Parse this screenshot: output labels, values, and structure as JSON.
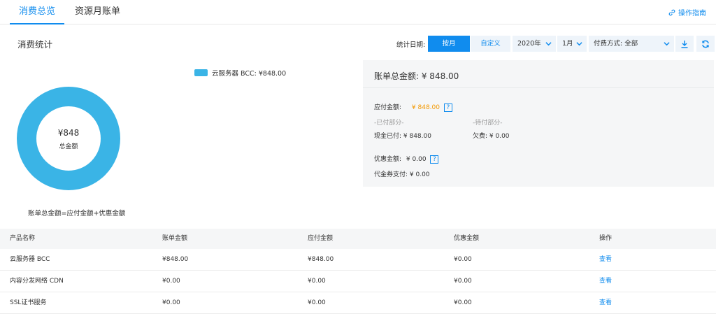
{
  "tabs": [
    {
      "label": "消费总览",
      "active": true
    },
    {
      "label": "资源月账单",
      "active": false
    }
  ],
  "guide_label": "操作指南",
  "section_title": "消费统计",
  "toolbar": {
    "date_label": "统计日期:",
    "month_btn": "按月",
    "custom_btn": "自定义",
    "year": "2020年",
    "month": "1月",
    "pay_method": "付费方式: 全部"
  },
  "chart_data": {
    "type": "pie",
    "categories": [
      "云服务器 BCC"
    ],
    "values": [
      848.0
    ],
    "legend": [
      "云服务器 BCC: ¥848.00"
    ],
    "center_value": "¥848",
    "center_label": "总金额",
    "colors": [
      "#3ab4e6"
    ]
  },
  "formula": "账单总金额=应付金额+优惠金额",
  "panel": {
    "total": "账单总金额:  ¥ 848.00",
    "payable_label": "应付金额:",
    "payable_value": "¥ 848.00",
    "paid_part": "-已付部分-",
    "pending_part": "-待付部分-",
    "cash_paid": "现金已付:  ¥ 848.00",
    "owed": "欠费:  ¥ 0.00",
    "discount_label": "优惠金额:",
    "discount_value": "¥ 0.00",
    "voucher": "代金券支付:  ¥ 0.00",
    "help": "?"
  },
  "table": {
    "headers": [
      "产品名称",
      "账单金额",
      "应付金额",
      "优惠金额",
      "操作"
    ],
    "rows": [
      {
        "name": "云服务器 BCC",
        "bill": "¥848.00",
        "payable": "¥848.00",
        "discount": "¥0.00",
        "action": "查看"
      },
      {
        "name": "内容分发网络 CDN",
        "bill": "¥0.00",
        "payable": "¥0.00",
        "discount": "¥0.00",
        "action": "查看"
      },
      {
        "name": "SSL证书服务",
        "bill": "¥0.00",
        "payable": "¥0.00",
        "discount": "¥0.00",
        "action": "查看"
      }
    ]
  },
  "colors": {
    "accent": "#108cee",
    "orange": "#f39800",
    "donut": "#3ab4e6"
  }
}
